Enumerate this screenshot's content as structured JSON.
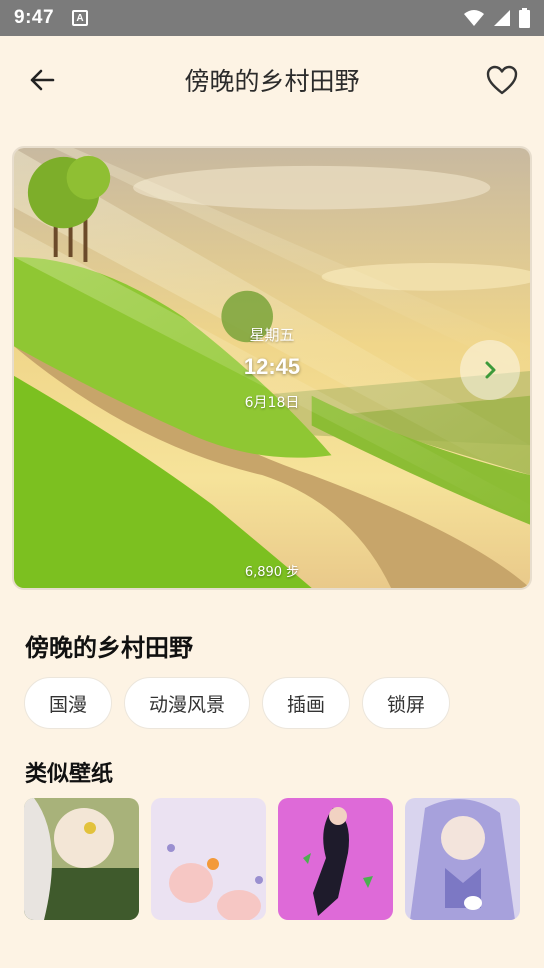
{
  "status_bar": {
    "time": "9:47",
    "notification_icon": "A",
    "icons": [
      "wifi-icon",
      "signal-icon",
      "battery-icon"
    ]
  },
  "header": {
    "title": "傍晚的乡村田野",
    "back_icon": "arrow-left-icon",
    "favorite_icon": "heart-outline-icon"
  },
  "preview": {
    "weekday": "星期五",
    "time": "12:45",
    "date": "6月18日",
    "steps": "6,890 步",
    "next_icon": "chevron-right-icon"
  },
  "wallpaper": {
    "title": "傍晚的乡村田野",
    "tags": [
      "国漫",
      "动漫风景",
      "插画",
      "锁屏"
    ]
  },
  "similar": {
    "title": "类似壁纸",
    "thumbnails": [
      "thumbnail-1",
      "thumbnail-2",
      "thumbnail-3",
      "thumbnail-4"
    ]
  },
  "colors": {
    "background": "#fdf3e4",
    "status_bar": "#7b7b7b",
    "accent_green": "#3d9a3a"
  }
}
